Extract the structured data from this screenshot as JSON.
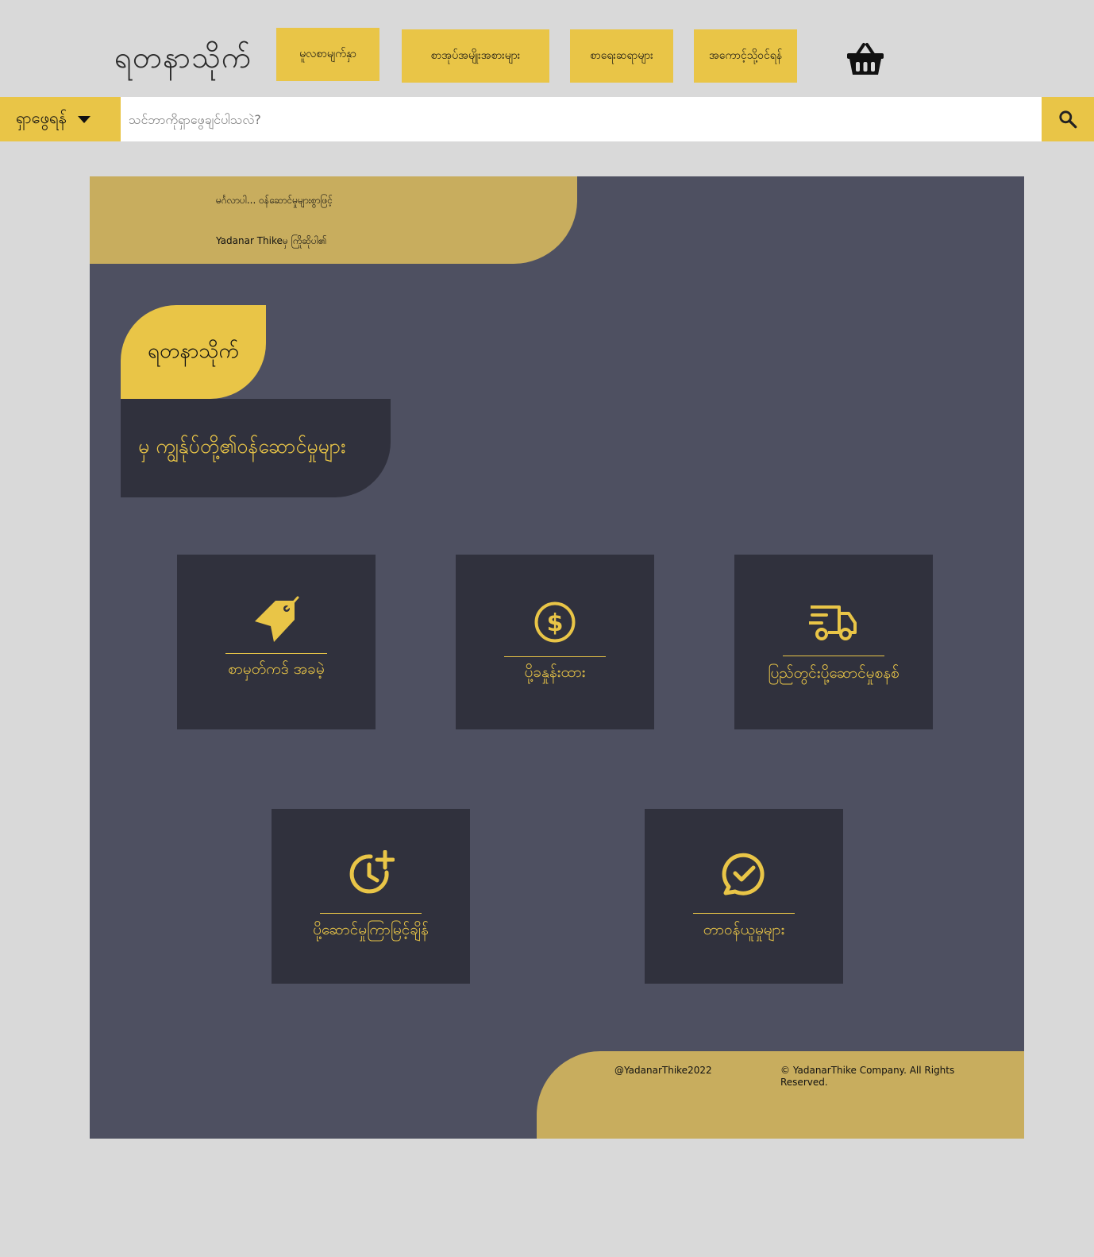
{
  "header": {
    "logo_text": "ရတနာသိုက်",
    "nav": [
      {
        "label": "မူလစာမျက်နှာ"
      },
      {
        "label": "စာအုပ်အမျိုးအစားများ"
      },
      {
        "label": "စာရေးဆရာများ"
      },
      {
        "label": "အကောင့်သို့ဝင်ရန်"
      }
    ],
    "cart_icon": "basket-icon"
  },
  "search": {
    "category_label": "ရှာဖွေရန်",
    "placeholder": "သင်ဘာကိုရှာဖွေချင်ပါသလဲ?",
    "button_icon": "search-icon"
  },
  "welcome": {
    "line1": "မင်္ဂလာပါ... ဝန်ဆောင်မှုများစွာဖြင့်",
    "line2": "Yadanar Thikeမှ ကြိုဆိုပါ၏"
  },
  "brand": {
    "name": "ရတနာသိုက်"
  },
  "services": {
    "heading": "မှ ကျွန်ုပ်တို့၏ဝန်ဆောင်မှုများ",
    "items": [
      {
        "label": "စာမှတ်ကဒ် အခမဲ့",
        "icon": "price-tag-icon"
      },
      {
        "label": "ပို့ခနှုန်းထား",
        "icon": "dollar-icon"
      },
      {
        "label": "ပြည်တွင်းပို့ဆောင်မှုစနစ်",
        "icon": "delivery-truck-icon"
      },
      {
        "label": "ပို့ဆောင်မှုကြာမြင့်ချိန်",
        "icon": "clock-plus-icon"
      },
      {
        "label": "တာဝန်ယူမှုများ",
        "icon": "check-chat-icon"
      }
    ]
  },
  "footer": {
    "handle": "@YadanarThike2022",
    "copyright": "© YadanarThike Company. All Rights Reserved."
  },
  "colors": {
    "accent": "#e9c547",
    "gold_muted": "#c8ad5e",
    "panel": "#4e5061",
    "card": "#30313d",
    "page_bg": "#d9d9d9"
  }
}
